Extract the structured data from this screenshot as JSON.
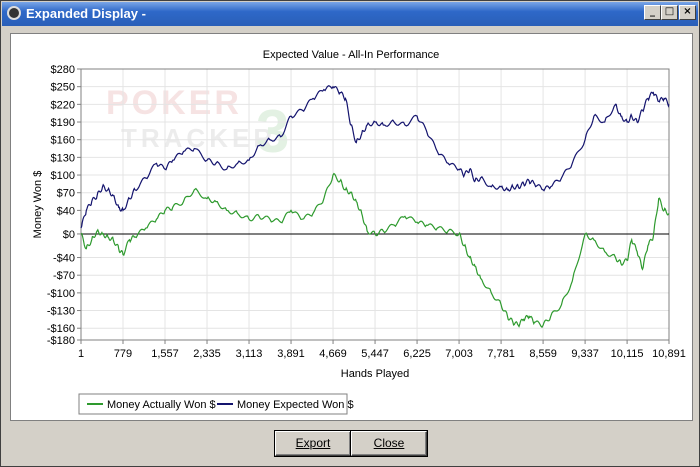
{
  "window": {
    "title": "Expanded Display -"
  },
  "window_controls": {
    "minimize": "_",
    "maximize": "□",
    "close": "×"
  },
  "watermark": {
    "line1": "POKER",
    "line2": "TRACKER",
    "number": "3"
  },
  "buttons": {
    "export": "Export",
    "close": "Close"
  },
  "colors": {
    "actual": "#2e9a2e",
    "expected": "#14146e",
    "zero_line": "#000000"
  },
  "chart_data": {
    "type": "line",
    "title": "Expected Value - All-In Performance",
    "xlabel": "Hands Played",
    "ylabel": "Money Won $",
    "xlim": [
      1,
      10891
    ],
    "ylim": [
      -180,
      280
    ],
    "x_ticks": [
      1,
      779,
      1557,
      2335,
      3113,
      3891,
      4669,
      5447,
      6225,
      7003,
      7781,
      8559,
      9337,
      10115,
      10891
    ],
    "x_tick_labels": [
      "1",
      "779",
      "1,557",
      "2,335",
      "3,113",
      "3,891",
      "4,669",
      "5,447",
      "6,225",
      "7,003",
      "7,781",
      "8,559",
      "9,337",
      "10,115",
      "10,891"
    ],
    "y_ticks": [
      280,
      250,
      220,
      190,
      160,
      130,
      100,
      70,
      40,
      0,
      -40,
      -70,
      -100,
      -130,
      -160,
      -180
    ],
    "y_tick_labels": [
      "$280",
      "$250",
      "$220",
      "$190",
      "$160",
      "$130",
      "$100",
      "$70",
      "$40",
      "$0",
      "-$40",
      "-$70",
      "-$100",
      "-$130",
      "-$160",
      "-$180"
    ],
    "grid": true,
    "legend": {
      "placement": "bottom-left"
    },
    "series": [
      {
        "name": "Money Actually Won $",
        "x": [
          1,
          100,
          200,
          300,
          400,
          500,
          600,
          700,
          779,
          900,
          1000,
          1200,
          1400,
          1557,
          1700,
          1900,
          2100,
          2335,
          2500,
          2700,
          2900,
          3113,
          3300,
          3500,
          3700,
          3891,
          4100,
          4300,
          4500,
          4669,
          4800,
          4900,
          5000,
          5100,
          5200,
          5300,
          5447,
          5600,
          5800,
          6000,
          6225,
          6400,
          6600,
          6800,
          7003,
          7100,
          7200,
          7300,
          7400,
          7600,
          7781,
          7900,
          8000,
          8100,
          8200,
          8300,
          8400,
          8559,
          8700,
          8900,
          9100,
          9337,
          9500,
          9700,
          9900,
          10000,
          10115,
          10200,
          10300,
          10400,
          10500,
          10600,
          10700,
          10800,
          10891
        ],
        "y": [
          0,
          -25,
          -10,
          5,
          0,
          -5,
          -10,
          -25,
          -35,
          -10,
          -5,
          10,
          25,
          40,
          45,
          55,
          75,
          60,
          55,
          40,
          35,
          25,
          30,
          25,
          20,
          40,
          25,
          35,
          60,
          100,
          90,
          75,
          70,
          55,
          35,
          5,
          0,
          5,
          15,
          30,
          20,
          15,
          10,
          5,
          0,
          -20,
          -40,
          -55,
          -75,
          -100,
          -120,
          -140,
          -150,
          -155,
          -145,
          -140,
          -150,
          -155,
          -140,
          -120,
          -80,
          0,
          -10,
          -30,
          -40,
          -50,
          -45,
          -10,
          -30,
          -60,
          -20,
          -5,
          60,
          40,
          35
        ]
      },
      {
        "name": "Money Expected Won $",
        "x": [
          1,
          100,
          200,
          300,
          400,
          500,
          600,
          700,
          779,
          900,
          1000,
          1200,
          1400,
          1557,
          1700,
          1900,
          2100,
          2335,
          2500,
          2700,
          2900,
          3113,
          3300,
          3500,
          3700,
          3891,
          4100,
          4300,
          4500,
          4669,
          4800,
          4900,
          5000,
          5100,
          5200,
          5300,
          5447,
          5600,
          5800,
          6000,
          6225,
          6400,
          6600,
          6800,
          7003,
          7100,
          7200,
          7300,
          7400,
          7600,
          7781,
          7900,
          8000,
          8100,
          8200,
          8300,
          8400,
          8559,
          8700,
          8900,
          9100,
          9337,
          9500,
          9700,
          9900,
          10000,
          10115,
          10200,
          10300,
          10400,
          10500,
          10600,
          10700,
          10800,
          10891
        ],
        "y": [
          10,
          40,
          55,
          65,
          80,
          75,
          65,
          45,
          40,
          60,
          75,
          95,
          120,
          110,
          125,
          140,
          145,
          125,
          120,
          110,
          120,
          125,
          150,
          160,
          165,
          200,
          210,
          230,
          245,
          250,
          240,
          230,
          185,
          155,
          170,
          185,
          190,
          185,
          190,
          185,
          200,
          175,
          140,
          120,
          110,
          100,
          110,
          90,
          95,
          80,
          80,
          75,
          80,
          80,
          85,
          90,
          85,
          75,
          80,
          95,
          120,
          160,
          200,
          190,
          220,
          200,
          190,
          200,
          190,
          210,
          230,
          240,
          225,
          230,
          220
        ]
      }
    ]
  }
}
